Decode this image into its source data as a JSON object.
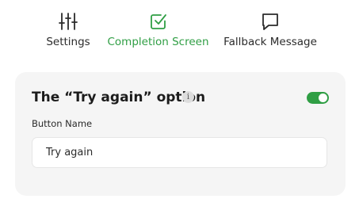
{
  "tabs": [
    {
      "label": "Settings",
      "icon": "sliders-icon",
      "active": false
    },
    {
      "label": "Completion Screen",
      "icon": "checkbox-icon",
      "active": true
    },
    {
      "label": "Fallback Message",
      "icon": "message-bubble-icon",
      "active": false
    }
  ],
  "card": {
    "title": "The “Try again” option",
    "info_icon": "i",
    "toggle_on": true,
    "field_label": "Button Name",
    "field_value": "Try again"
  },
  "colors": {
    "accent": "#2f9e44",
    "card_bg": "#f5f5f5"
  }
}
